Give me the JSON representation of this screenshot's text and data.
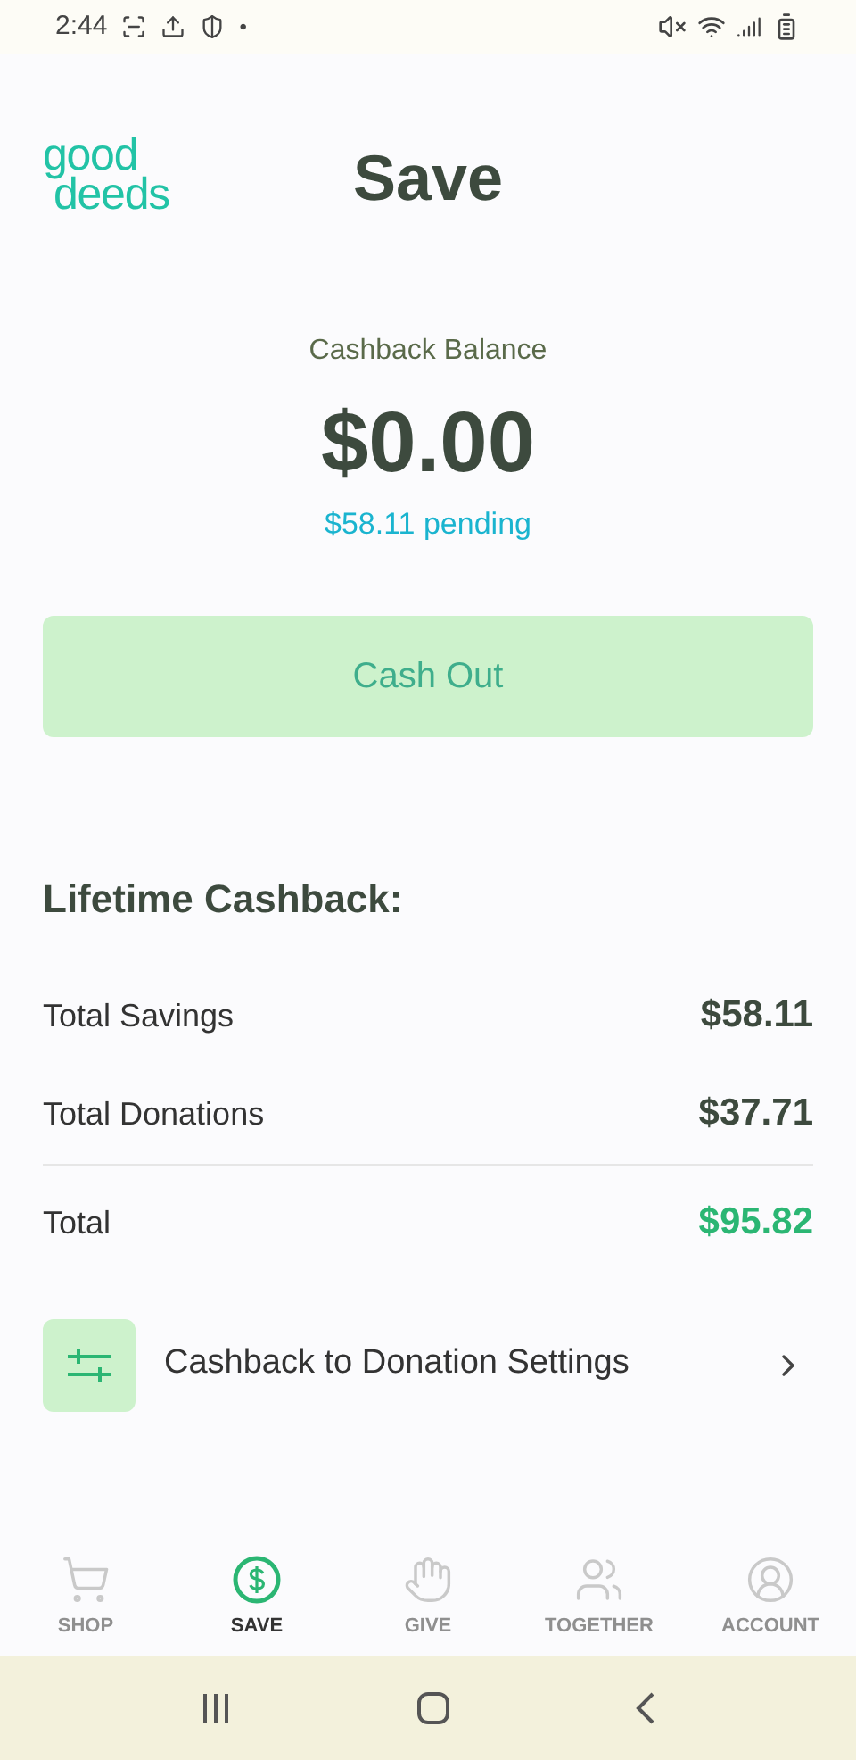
{
  "status_bar": {
    "time": "2:44",
    "dot": "•"
  },
  "header": {
    "logo": [
      "good",
      "deeds"
    ],
    "title": "Save"
  },
  "balance": {
    "label": "Cashback Balance",
    "amount": "$0.00",
    "pending": "$58.11 pending"
  },
  "cash_out_button": {
    "label": "Cash Out",
    "disabled": true
  },
  "lifetime": {
    "heading": "Lifetime Cashback:",
    "rows": [
      {
        "label": "Total Savings",
        "value": "$58.11",
        "kind": "line"
      },
      {
        "label": "Total Donations",
        "value": "$37.71",
        "kind": "line"
      },
      {
        "label": "Total",
        "value": "$95.82",
        "kind": "total"
      }
    ]
  },
  "settings_link": {
    "label": "Cashback to Donation Settings"
  },
  "tab_bar": [
    {
      "label": "SHOP",
      "kind": "cart",
      "selected": false
    },
    {
      "label": "SAVE",
      "kind": "dollar",
      "selected": true
    },
    {
      "label": "GIVE",
      "kind": "hand",
      "selected": false
    },
    {
      "label": "TOGETHER",
      "kind": "people",
      "selected": false
    },
    {
      "label": "ACCOUNT",
      "kind": "person",
      "selected": false
    }
  ]
}
